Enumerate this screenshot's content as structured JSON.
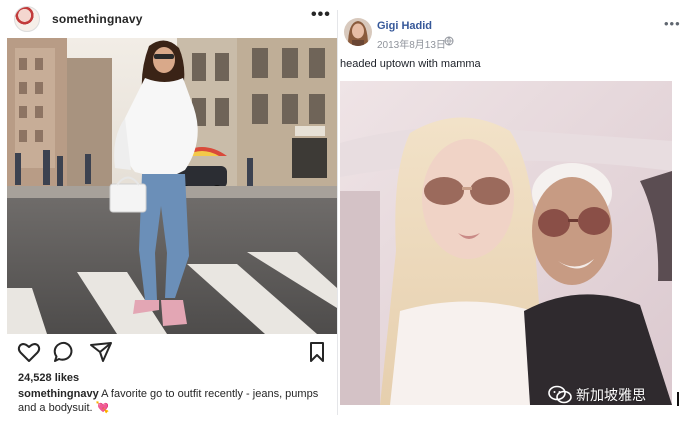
{
  "instagram": {
    "username": "somethingnavy",
    "more_label": "•••",
    "likes": "24,528 likes",
    "caption_user": "somethingnavy",
    "caption_text": " A favorite go to outfit recently - jeans, pumps and a bodysuit.",
    "caption_emoji": "💘",
    "icons": [
      "heart-icon",
      "comment-icon",
      "share-icon",
      "bookmark-icon"
    ]
  },
  "facebook": {
    "name": "Gigi Hadid",
    "date": "2013年8月13日",
    "more_label": "•••",
    "post_text": "headed uptown with mamma",
    "icons": [
      "globe-icon",
      "more-icon"
    ]
  },
  "watermark": {
    "text": "新加坡雅思",
    "icon": "wechat-icon"
  },
  "colors": {
    "fb_blue": "#365899",
    "ig_text": "#262626",
    "fb_meta": "#90949c"
  }
}
